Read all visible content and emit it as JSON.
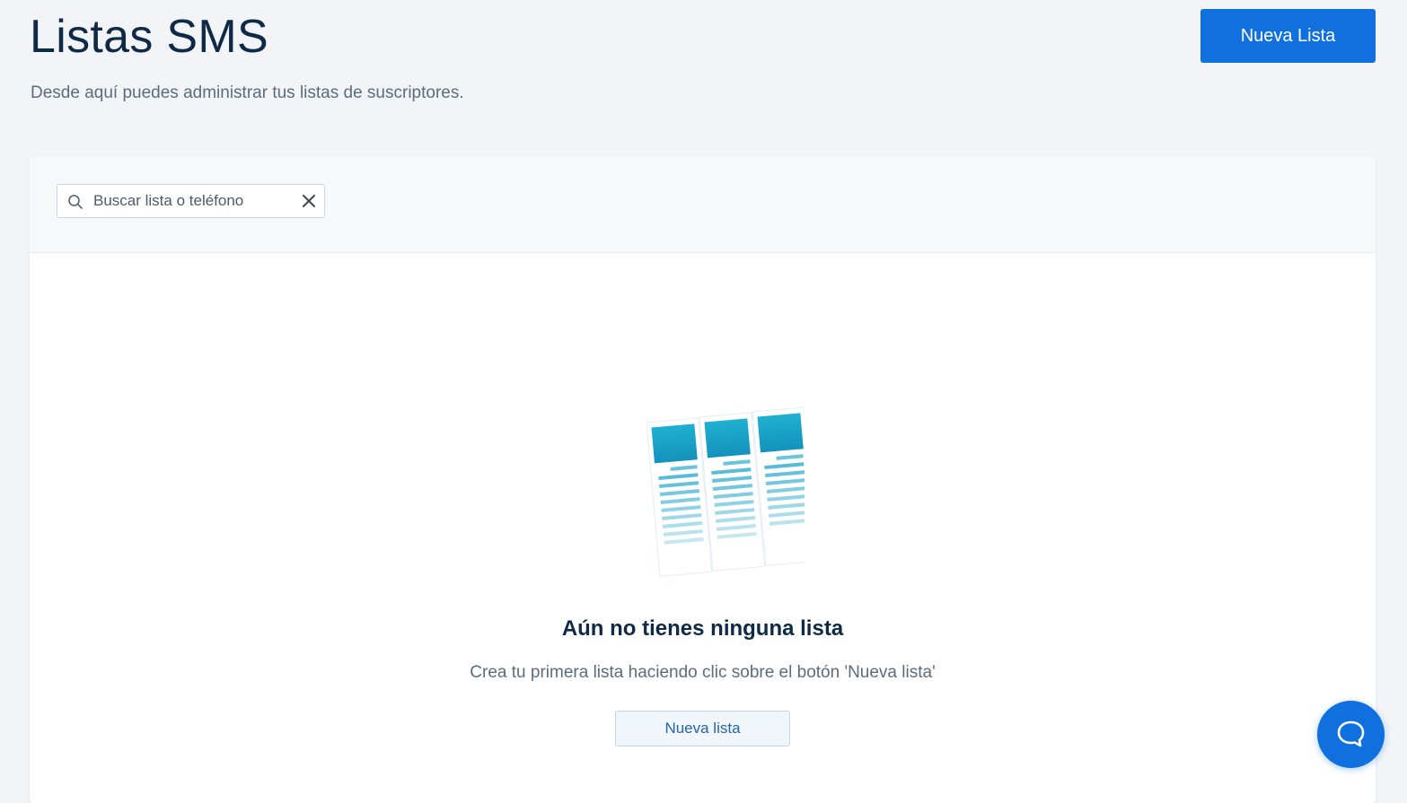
{
  "header": {
    "title": "Listas SMS",
    "subtitle": "Desde aquí puedes administrar tus listas de suscriptores.",
    "new_list_button": "Nueva Lista"
  },
  "search": {
    "placeholder": "Buscar lista o teléfono",
    "value": ""
  },
  "empty_state": {
    "title": "Aún no tienes ninguna lista",
    "description": "Crea tu primera lista haciendo clic sobre el botón 'Nueva lista'",
    "button_label": "Nueva lista",
    "illustration": "lists-icon"
  },
  "chat": {
    "icon": "chat-bubble-icon"
  },
  "colors": {
    "primary": "#1070e0",
    "title": "#0e2a47",
    "muted": "#5c6c7e",
    "background": "#f2f4f7",
    "illustration_accent": "#1aa3c8"
  }
}
